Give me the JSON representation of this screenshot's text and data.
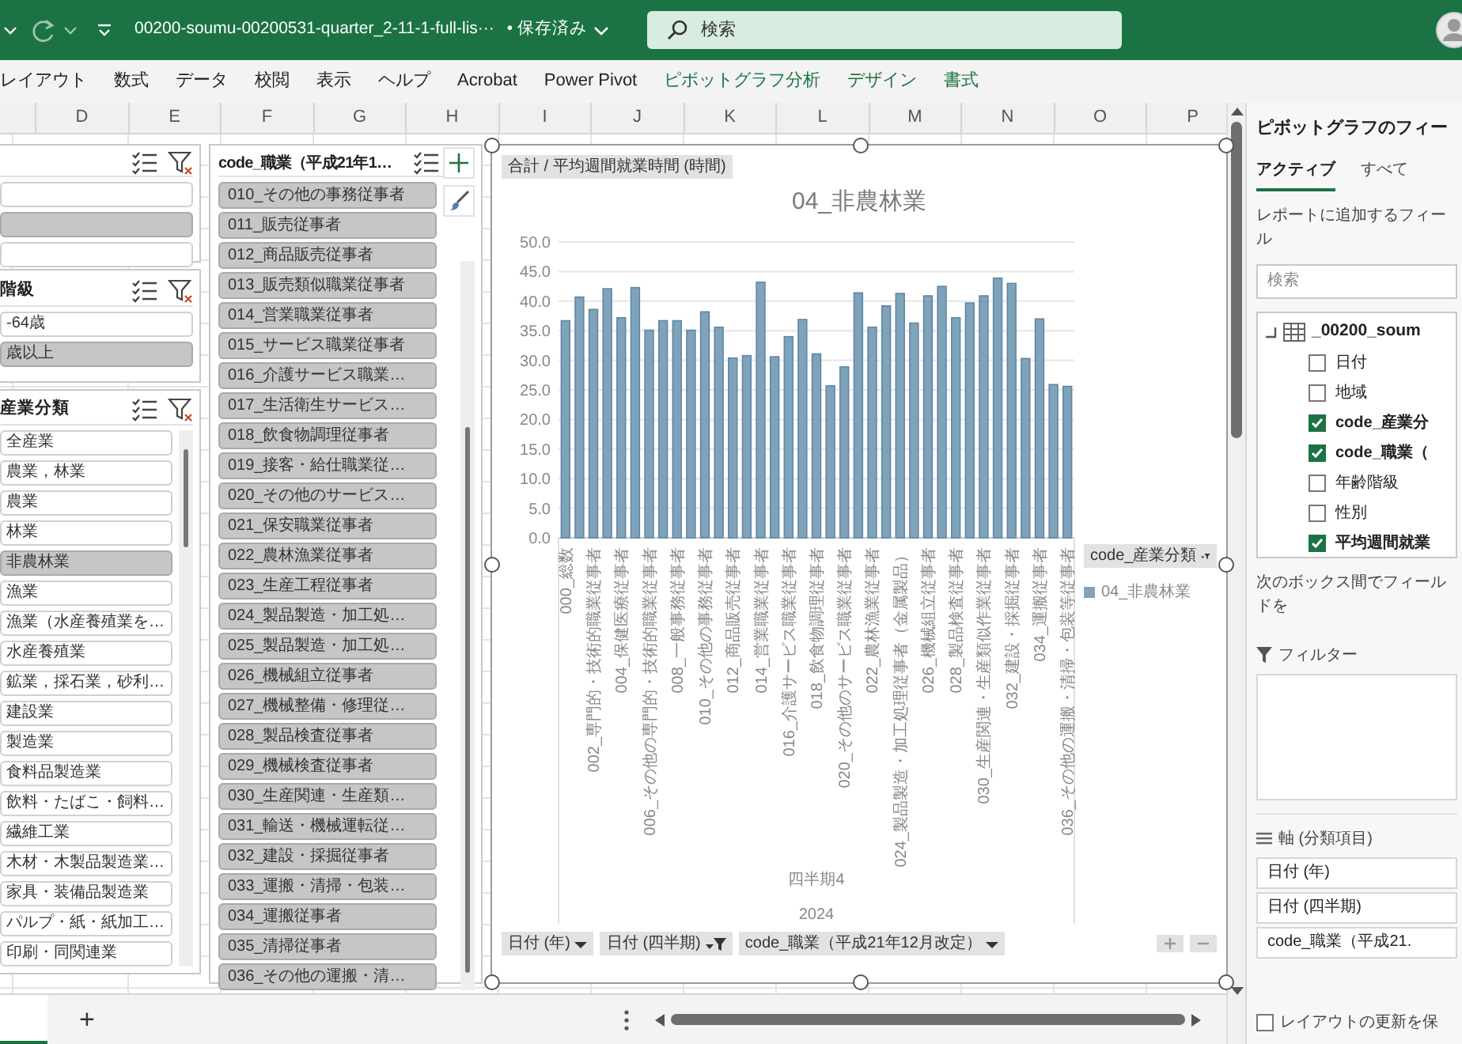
{
  "title_bar": {
    "file_name": "00200-soumu-00200531-quarter_2-11-1-full-lis···",
    "save_status": "• 保存済み",
    "search": {
      "placeholder": "検索"
    }
  },
  "ribbon_tabs": [
    {
      "label": "レイアウト",
      "contextual": false
    },
    {
      "label": "数式",
      "contextual": false
    },
    {
      "label": "データ",
      "contextual": false
    },
    {
      "label": "校閲",
      "contextual": false
    },
    {
      "label": "表示",
      "contextual": false
    },
    {
      "label": "ヘルプ",
      "contextual": false
    },
    {
      "label": "Acrobat",
      "contextual": false
    },
    {
      "label": "Power Pivot",
      "contextual": false
    },
    {
      "label": "ピボットグラフ分析",
      "contextual": true
    },
    {
      "label": "デザイン",
      "contextual": true
    },
    {
      "label": "書式",
      "contextual": true
    }
  ],
  "column_headers": [
    "D",
    "E",
    "F",
    "G",
    "H",
    "I",
    "J",
    "K",
    "L",
    "M",
    "N",
    "O",
    "P"
  ],
  "left_slicers": [
    {
      "items": [
        {
          "selected": false
        },
        {
          "selected": true
        },
        {
          "selected": false
        }
      ]
    },
    {
      "title": "階級",
      "items": [
        {
          "label": "-64歳",
          "selected": false
        },
        {
          "label": "歳以上",
          "selected": true
        }
      ]
    },
    {
      "title": "産業分類",
      "items": [
        {
          "label": "全産業",
          "selected": false
        },
        {
          "label": "農業，林業",
          "selected": false
        },
        {
          "label": "農業",
          "selected": false
        },
        {
          "label": "林業",
          "selected": false
        },
        {
          "label": "非農林業",
          "selected": true
        },
        {
          "label": "漁業",
          "selected": false
        },
        {
          "label": "漁業（水産養殖業を…",
          "selected": false
        },
        {
          "label": "水産養殖業",
          "selected": false
        },
        {
          "label": "鉱業，採石業，砂利…",
          "selected": false
        },
        {
          "label": "建設業",
          "selected": false
        },
        {
          "label": "製造業",
          "selected": false
        },
        {
          "label": "食料品製造業",
          "selected": false
        },
        {
          "label": "飲料・たばこ・飼料…",
          "selected": false
        },
        {
          "label": "繊維工業",
          "selected": false
        },
        {
          "label": "木材・木製品製造業…",
          "selected": false
        },
        {
          "label": "家具・装備品製造業",
          "selected": false
        },
        {
          "label": "パルプ・紙・紙加工…",
          "selected": false
        },
        {
          "label": "印刷・同関連業",
          "selected": false
        }
      ]
    }
  ],
  "middle_slicer": {
    "title": "code_職業（平成21年1…",
    "items": [
      {
        "label": "010_その他の事務従事者",
        "selected": true
      },
      {
        "label": "011_販売従事者",
        "selected": true
      },
      {
        "label": "012_商品販売従事者",
        "selected": true
      },
      {
        "label": "013_販売類似職業従事者",
        "selected": true
      },
      {
        "label": "014_営業職業従事者",
        "selected": true
      },
      {
        "label": "015_サービス職業従事者",
        "selected": true
      },
      {
        "label": "016_介護サービス職業…",
        "selected": true
      },
      {
        "label": "017_生活衛生サービス…",
        "selected": true
      },
      {
        "label": "018_飲食物調理従事者",
        "selected": true
      },
      {
        "label": "019_接客・給仕職業従…",
        "selected": true
      },
      {
        "label": "020_その他のサービス…",
        "selected": true
      },
      {
        "label": "021_保安職業従事者",
        "selected": true
      },
      {
        "label": "022_農林漁業従事者",
        "selected": true
      },
      {
        "label": "023_生産工程従事者",
        "selected": true
      },
      {
        "label": "024_製品製造・加工処…",
        "selected": true
      },
      {
        "label": "025_製品製造・加工処…",
        "selected": true
      },
      {
        "label": "026_機械組立従事者",
        "selected": true
      },
      {
        "label": "027_機械整備・修理従…",
        "selected": true
      },
      {
        "label": "028_製品検査従事者",
        "selected": true
      },
      {
        "label": "029_機械検査従事者",
        "selected": true
      },
      {
        "label": "030_生産関連・生産類…",
        "selected": true
      },
      {
        "label": "031_輸送・機械運転従…",
        "selected": true
      },
      {
        "label": "032_建設・採掘従事者",
        "selected": true
      },
      {
        "label": "033_運搬・清掃・包装…",
        "selected": true
      },
      {
        "label": "034_運搬従事者",
        "selected": true
      },
      {
        "label": "035_清掃従事者",
        "selected": true
      },
      {
        "label": "036_その他の運搬・清…",
        "selected": true
      }
    ]
  },
  "chart": {
    "value_field_button": "合計 / 平均週間就業時間 (時間)",
    "legend_field_button": "code_産業分類",
    "axis_group_labels": [
      "四半期4",
      "2024"
    ],
    "axis_field_buttons": [
      {
        "label": "日付 (年)",
        "filtered": false
      },
      {
        "label": "日付 (四半期)",
        "filtered": true
      },
      {
        "label": "code_職業（平成21年12月改定）",
        "filtered": false
      }
    ],
    "chart_data": {
      "type": "bar",
      "title": "04_非農林業",
      "grid": true,
      "categories": [
        "000_総数",
        null,
        "002_専門的・技術的職業従事者",
        null,
        "004_保健医療従事者",
        null,
        "006_その他の専門的・技術的職業従事者",
        null,
        "008_一般事務従事者",
        null,
        "010_その他の事務従事者",
        null,
        "012_商品販売従事者",
        null,
        "014_営業職業従事者",
        null,
        "016_介護サービス職業従事者",
        null,
        "018_飲食物調理従事者",
        null,
        "020_その他のサービス職業従事者",
        null,
        "022_農林漁業従事者",
        null,
        "024_製品製造・加工処理従事者（金属製品）",
        null,
        "026_機械組立従事者",
        null,
        "028_製品検査従事者",
        null,
        "030_生産関連・生産類似作業従事者",
        null,
        "032_建設・採掘従事者",
        null,
        "034_運搬従事者",
        null,
        "036_その他の運搬・清掃・包装等従事者"
      ],
      "series": [
        {
          "name": "04_非農林業",
          "color": "#7fa3bb",
          "values": [
            36.7,
            40.7,
            38.6,
            42.1,
            37.2,
            42.3,
            35.1,
            36.7,
            36.7,
            35.1,
            38.2,
            35.6,
            30.4,
            30.8,
            43.2,
            30.6,
            34.0,
            36.9,
            31.1,
            25.7,
            28.9,
            41.4,
            35.6,
            39.2,
            41.3,
            36.3,
            40.9,
            42.5,
            37.2,
            39.7,
            40.9,
            43.9,
            43.0,
            30.3,
            37.0,
            25.9,
            25.6
          ]
        }
      ],
      "ylim": [
        0,
        50
      ],
      "yticks": [
        {
          "value": 0,
          "label": "0.0"
        },
        {
          "value": 5,
          "label": "5.0"
        },
        {
          "value": 10,
          "label": "10.0"
        },
        {
          "value": 15,
          "label": "15.0"
        },
        {
          "value": 20,
          "label": "20.0"
        },
        {
          "value": 25,
          "label": "25.0"
        },
        {
          "value": 30,
          "label": "30.0"
        },
        {
          "value": 35,
          "label": "35.0"
        },
        {
          "value": 40,
          "label": "40.0"
        },
        {
          "value": 45,
          "label": "45.0"
        },
        {
          "value": 50,
          "label": "50.0"
        }
      ]
    }
  },
  "field_list": {
    "title": "ピボットグラフのフィー",
    "tabs": [
      {
        "label": "アクティブ",
        "selected": true
      },
      {
        "label": "すべて",
        "selected": false
      }
    ],
    "instruction": "レポートに追加するフィール",
    "search": {
      "placeholder": "検索"
    },
    "table_name": "_00200_soum",
    "fields": [
      {
        "label": "日付",
        "checked": false
      },
      {
        "label": "地域",
        "checked": false
      },
      {
        "label": "code_産業分",
        "checked": true
      },
      {
        "label": "code_職業（",
        "checked": true
      },
      {
        "label": "年齢階級",
        "checked": false
      },
      {
        "label": "性別",
        "checked": false
      },
      {
        "label": "平均週間就業",
        "checked": true
      }
    ],
    "areas_hint": "次のボックス間でフィールドを",
    "filter_area_title": "フィルター",
    "axis_area": {
      "title": "軸 (分類項目)",
      "items": [
        "日付 (年)",
        "日付 (四半期)",
        "code_職業（平成21."
      ]
    },
    "defer_update": {
      "label": "レイアウトの更新を保",
      "checked": false
    }
  },
  "bottom_bar": {
    "add_sheet": "+"
  }
}
